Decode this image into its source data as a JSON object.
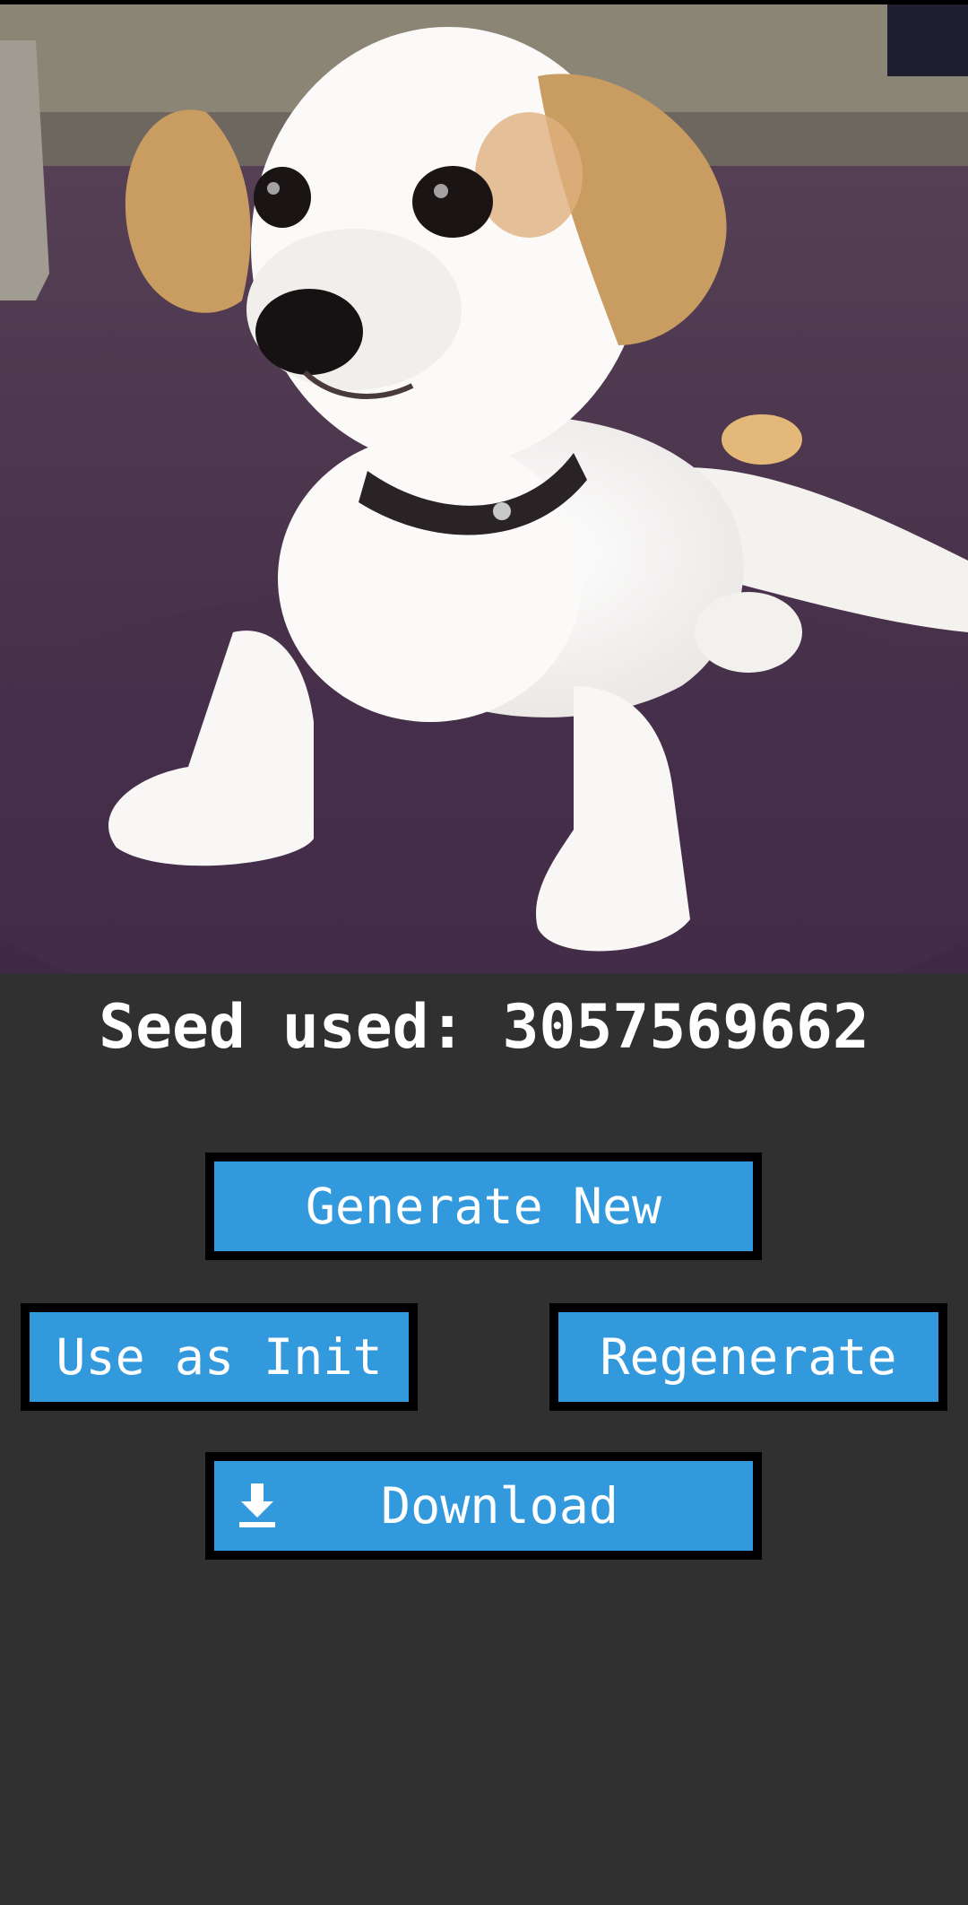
{
  "image": {
    "alt": "generated image of a puppy on a purple carpet"
  },
  "seed": {
    "label": "Seed used: 3057569662"
  },
  "actions": {
    "generate_new_label": "Generate New",
    "use_as_init_label": "Use as Init",
    "regenerate_label": "Regenerate",
    "download_label": "Download"
  },
  "icons": {
    "download": "download-icon"
  },
  "colors": {
    "background": "#303030",
    "button": "#3399dd",
    "button_border": "#000000",
    "text": "#ffffff",
    "carpet": "#4e3550"
  }
}
